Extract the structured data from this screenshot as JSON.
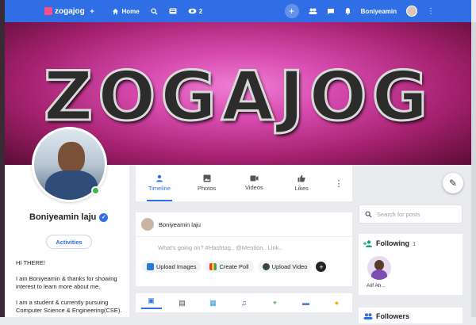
{
  "nav": {
    "brand": "zogajog",
    "home": "Home",
    "watch_count": "2",
    "username": "Boniyeamin"
  },
  "cover": {
    "title": "ZOGAJOG"
  },
  "profile": {
    "name": "Boniyeamin laju",
    "activities_label": "Activities",
    "about": [
      "HI THERE!",
      "I am Boniyeamin & thanks for showing interest to learn more about me.",
      "I am a student & currently pursuing Computer Science & Engineering(CSE)."
    ]
  },
  "tabs": [
    {
      "label": "Timeline",
      "icon": "person-icon",
      "active": true
    },
    {
      "label": "Photos",
      "icon": "image-icon"
    },
    {
      "label": "Videos",
      "icon": "video-icon"
    },
    {
      "label": "Likes",
      "icon": "thumb-up-icon"
    }
  ],
  "composer": {
    "author": "Boniyeamin laju",
    "placeholder": "What's going on? #Hashtag.. @Mention.. Link..",
    "upload_images": "Upload Images",
    "create_poll": "Create Poll",
    "upload_video": "Upload Video"
  },
  "sidebar": {
    "search_placeholder": "Search for posts",
    "following_title": "Following",
    "following_count": "1",
    "following_user": "Alif Ah...",
    "followers_title": "Followers"
  },
  "colors": {
    "nav_blue": "#2f6ee4",
    "online": "#3cb54a"
  }
}
